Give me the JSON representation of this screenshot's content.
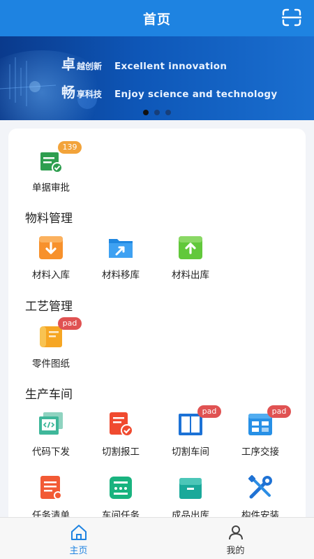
{
  "header": {
    "title": "首页",
    "scan_icon": "scan-icon"
  },
  "banner": {
    "line1_big": "卓",
    "line1_small": "越创新",
    "line1_en": "Excellent innovation",
    "line2_big": "畅",
    "line2_small": "享科技",
    "line2_en": "Enjoy science and technology",
    "active_slide": 1,
    "slide_count": 3
  },
  "top_item": {
    "label": "单据审批",
    "badge": "139",
    "icon": "document-approve-icon"
  },
  "sections": {
    "materials": {
      "title": "物料管理",
      "items": [
        {
          "label": "材料入库",
          "icon": "inbox-in-icon"
        },
        {
          "label": "材料移库",
          "icon": "folder-move-icon"
        },
        {
          "label": "材料出库",
          "icon": "inbox-out-icon"
        }
      ]
    },
    "process": {
      "title": "工艺管理",
      "items": [
        {
          "label": "零件图纸",
          "icon": "drawing-scroll-icon",
          "badge": "pad"
        }
      ]
    },
    "workshop": {
      "title": "生产车间",
      "items": [
        {
          "label": "代码下发",
          "icon": "code-icon"
        },
        {
          "label": "切割报工",
          "icon": "cut-report-icon"
        },
        {
          "label": "切割车间",
          "icon": "book-panel-icon",
          "badge": "pad"
        },
        {
          "label": "工序交接",
          "icon": "handover-icon",
          "badge": "pad"
        },
        {
          "label": "任务清单",
          "icon": "task-list-icon"
        },
        {
          "label": "车间任务",
          "icon": "workshop-task-icon"
        },
        {
          "label": "成品出库",
          "icon": "product-box-icon"
        },
        {
          "label": "构件安装",
          "icon": "tools-icon"
        }
      ]
    }
  },
  "tabbar": {
    "home": {
      "label": "主页",
      "icon": "home-icon"
    },
    "mine": {
      "label": "我的",
      "icon": "user-icon"
    }
  },
  "colors": {
    "primary": "#1e83e1",
    "badge_orange": "#f2a33a",
    "badge_red": "#e05252"
  }
}
